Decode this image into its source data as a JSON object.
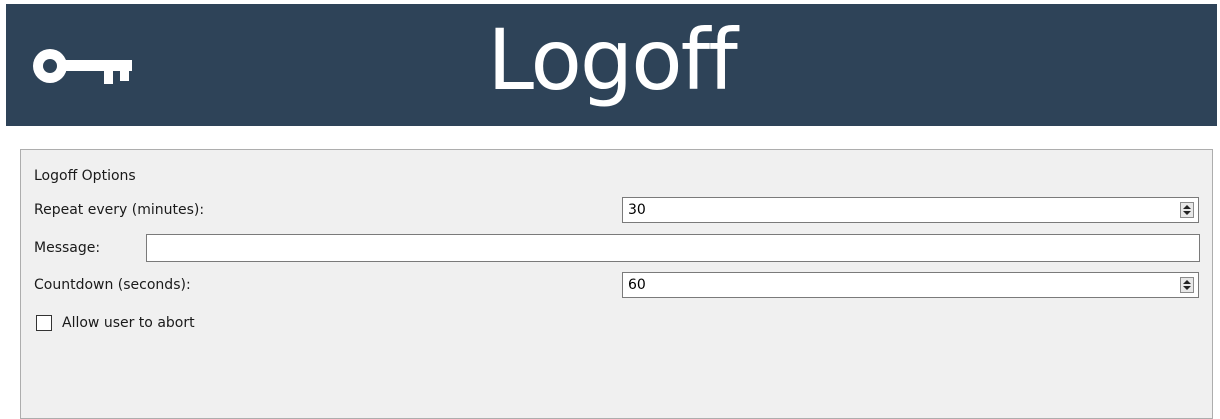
{
  "header": {
    "title": "Logoff",
    "icon": "key-icon",
    "background_color": "#2e4358"
  },
  "options": {
    "group_title": "Logoff Options",
    "repeat_label": "Repeat every (minutes):",
    "repeat_value": "30",
    "message_label": "Message:",
    "message_value": "",
    "countdown_label": "Countdown (seconds):",
    "countdown_value": "60",
    "allow_abort_label": "Allow user to abort",
    "allow_abort_checked": false
  }
}
